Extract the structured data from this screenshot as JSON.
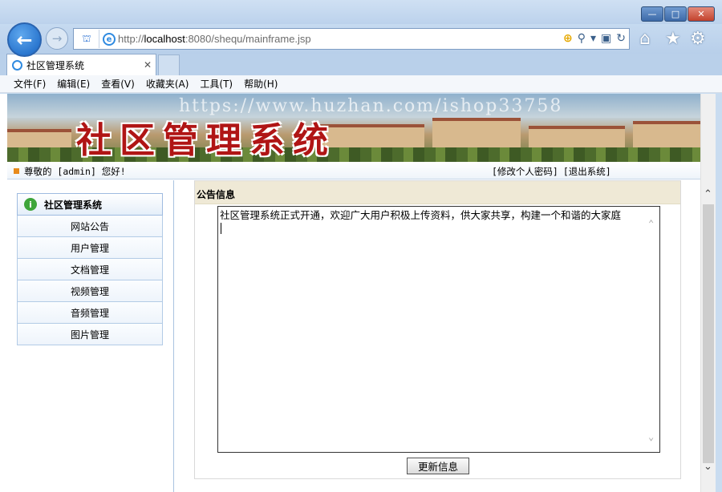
{
  "browser": {
    "url_prefix": "http://",
    "url_host": "localhost",
    "url_rest": ":8080/shequ/mainframe.jsp",
    "tab_title": "社区管理系统",
    "menu": [
      "文件(F)",
      "编辑(E)",
      "查看(V)",
      "收藏夹(A)",
      "工具(T)",
      "帮助(H)"
    ]
  },
  "banner": {
    "title": "社区管理系统",
    "watermark": "https://www.huzhan.com/ishop33758"
  },
  "infobar": {
    "greeting": "尊敬的 [admin] 您好!",
    "change_password": "[修改个人密码]",
    "logout": "[退出系统]"
  },
  "sidebar": {
    "heading": "社区管理系统",
    "items": [
      "网站公告",
      "用户管理",
      "文档管理",
      "视频管理",
      "音频管理",
      "图片管理"
    ]
  },
  "main": {
    "panel_title": "公告信息",
    "notice_text": "社区管理系统正式开通，欢迎广大用户积极上传资料，供大家共享，构建一个和谐的大家庭",
    "update_button": "更新信息"
  },
  "colors": {
    "banner_title": "#b01515",
    "panel_head": "#efe9d6",
    "sidebar_border": "#a9c3e0"
  }
}
